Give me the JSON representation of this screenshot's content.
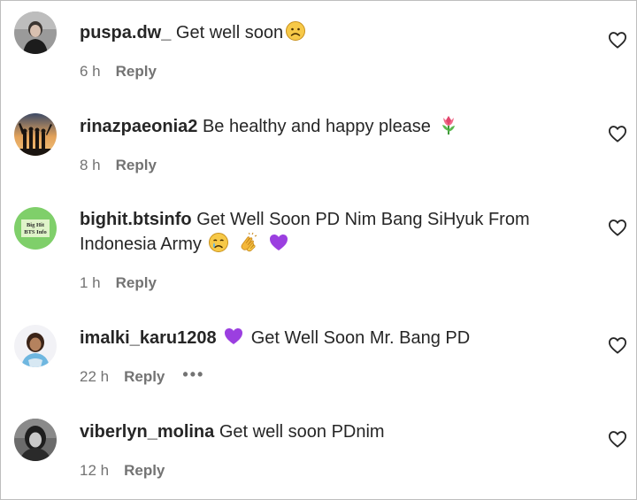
{
  "comments": [
    {
      "username": "puspa.dw_",
      "text": "Get well soon",
      "emojis": [
        "frowning-face"
      ],
      "time": "6 h",
      "reply_label": "Reply"
    },
    {
      "username": "rinazpaeonia2",
      "text": "Be healthy and happy please",
      "emojis": [
        "tulip"
      ],
      "time": "8 h",
      "reply_label": "Reply"
    },
    {
      "username": "bighit.btsinfo",
      "text_line1": "Get Well Soon PD Nim Bang SiHyuk From",
      "text_line2": "Indonesia Army",
      "emojis": [
        "crying-face",
        "clapping-hands",
        "purple-heart"
      ],
      "avatar_text_1": "Big Hit",
      "avatar_text_2": "BTS Info",
      "time": "1 h",
      "reply_label": "Reply"
    },
    {
      "username": "imalki_karu1208",
      "text": "Get Well Soon Mr. Bang PD",
      "emojis": [
        "purple-heart"
      ],
      "time": "22 h",
      "reply_label": "Reply",
      "more_label": "•••"
    },
    {
      "username": "viberlyn_molina",
      "text": "Get well soon PDnim",
      "emojis": [],
      "time": "12 h",
      "reply_label": "Reply"
    }
  ],
  "colors": {
    "text": "#262626",
    "secondary": "#737373",
    "border": "#bdbdbd",
    "purple_heart": "#9b3fe0"
  },
  "icons": {
    "like": "heart-outline-icon"
  }
}
